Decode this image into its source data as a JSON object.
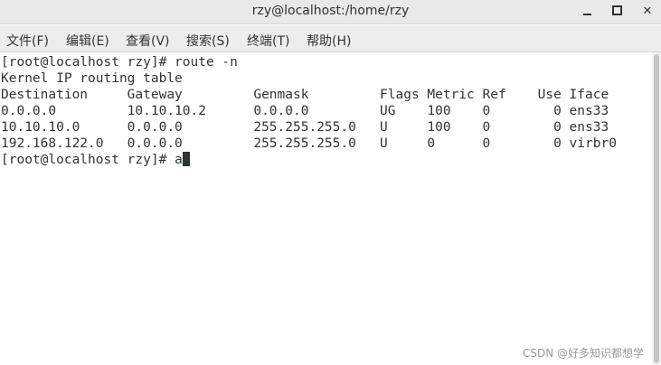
{
  "window": {
    "title": "rzy@localhost:/home/rzy",
    "minimize_icon": "minimize-icon",
    "maximize_icon": "maximize-icon",
    "close_icon": "close-icon"
  },
  "menu": {
    "items": [
      {
        "label": "文件(F)"
      },
      {
        "label": "编辑(E)"
      },
      {
        "label": "查看(V)"
      },
      {
        "label": "搜索(S)"
      },
      {
        "label": "终端(T)"
      },
      {
        "label": "帮助(H)"
      }
    ]
  },
  "terminal": {
    "lines": [
      "[root@localhost rzy]# route -n",
      "Kernel IP routing table",
      "Destination     Gateway         Genmask         Flags Metric Ref    Use Iface",
      "0.0.0.0         10.10.10.2      0.0.0.0         UG    100    0        0 ens33",
      "10.10.10.0      0.0.0.0         255.255.255.0   U     100    0        0 ens33",
      "192.168.122.0   0.0.0.0         255.255.255.0   U     0      0        0 virbr0"
    ],
    "prompt": "[root@localhost rzy]# ",
    "input": "a"
  },
  "watermark": "CSDN @好多知识都想学"
}
